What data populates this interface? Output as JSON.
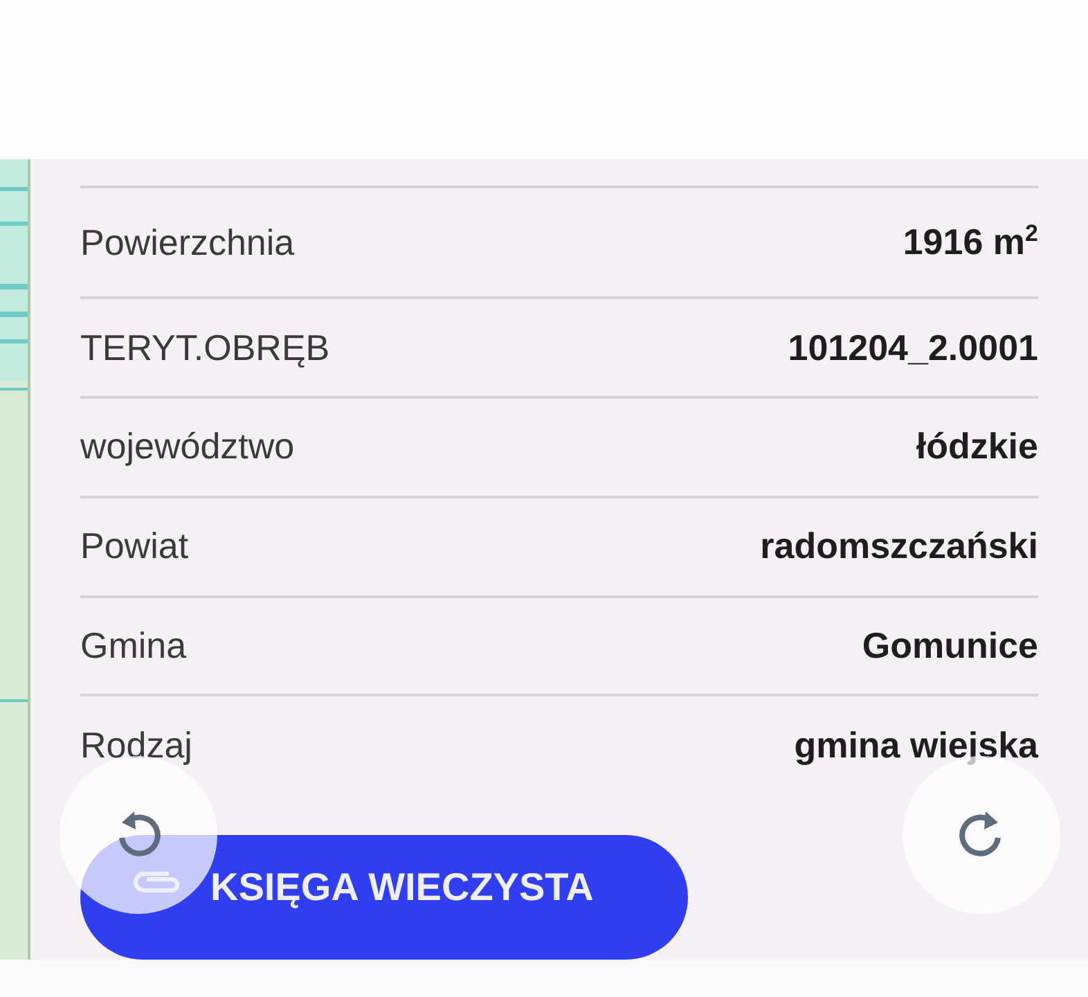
{
  "details": [
    {
      "label": "Powierzchnia",
      "value": "1916 m$^{2}$"
    },
    {
      "label": "TERYT.OBRĘB",
      "value": "101204_2.0001"
    },
    {
      "label": "województwo",
      "value": "łódzkie"
    },
    {
      "label": "Powiat",
      "value": "radomszczański"
    },
    {
      "label": "Gmina",
      "value": "Gomunice"
    },
    {
      "label": "Rodzaj",
      "value": "gmina wiejska"
    }
  ],
  "action_button": {
    "label": "KSIĘGA WIECZYSTA"
  }
}
